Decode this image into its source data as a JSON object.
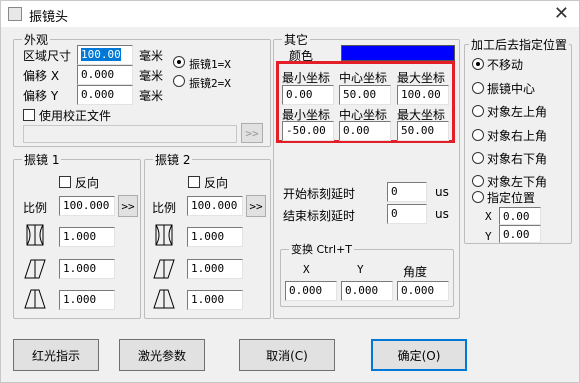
{
  "window": {
    "title": "振镜头"
  },
  "appearance": {
    "legend": "外观",
    "area_label": "区域尺寸",
    "area_value": "100.00",
    "offset_x_label": "偏移 X",
    "offset_x_value": "0.000",
    "offset_y_label": "偏移 Y",
    "offset_y_value": "0.000",
    "unit1": "毫米",
    "unit2": "毫米",
    "unit3": "毫米",
    "radio1": "振镜1=X",
    "radio2": "振镜2=X",
    "correction_label": "使用校正文件",
    "correction_path": "",
    "browse_label": ">>"
  },
  "mirror1": {
    "legend": "振镜 1",
    "reverse_label": "反向",
    "ratio_label": "比例",
    "ratio_value": "100.000",
    "btn_label": ">>",
    "v1": "1.000",
    "v2": "1.000",
    "v3": "1.000"
  },
  "mirror2": {
    "legend": "振镜 2",
    "reverse_label": "反向",
    "ratio_label": "比例",
    "ratio_value": "100.000",
    "btn_label": ">>",
    "v1": "1.000",
    "v2": "1.000",
    "v3": "1.000"
  },
  "other": {
    "legend": "其它",
    "color_label": "颜色",
    "color_value": "#0000ff",
    "min_label": "最小坐标",
    "center_label": "中心坐标",
    "max_label": "最大坐标",
    "row1_min": "0.00",
    "row1_center": "50.00",
    "row1_max": "100.00",
    "row2_min": "-50.00",
    "row2_center": "0.00",
    "row2_max": "50.00",
    "start_delay_label": "开始标刻延时",
    "start_delay_value": "0",
    "end_delay_label": "结束标刻延时",
    "end_delay_value": "0",
    "unit_us1": "us",
    "unit_us2": "us"
  },
  "transform": {
    "legend": "变换  Ctrl+T",
    "x_label": "X",
    "y_label": "Y",
    "angle_label": "角度",
    "x_value": "0.000",
    "y_value": "0.000",
    "angle_value": "0.000"
  },
  "position": {
    "legend": "加工后去指定位置",
    "options": [
      "不移动",
      "振镜中心",
      "对象左上角",
      "对象右上角",
      "对象右下角",
      "对象左下角",
      "指定位置"
    ],
    "x_label": "X",
    "y_label": "Y",
    "x_value": "0.00",
    "y_value": "0.00"
  },
  "buttons": {
    "red_light": "红光指示",
    "laser_params": "激光参数",
    "cancel": "取消(C)",
    "ok": "确定(O)"
  },
  "colors": {
    "accent": "#0078d7",
    "highlight": "#e41e26"
  }
}
